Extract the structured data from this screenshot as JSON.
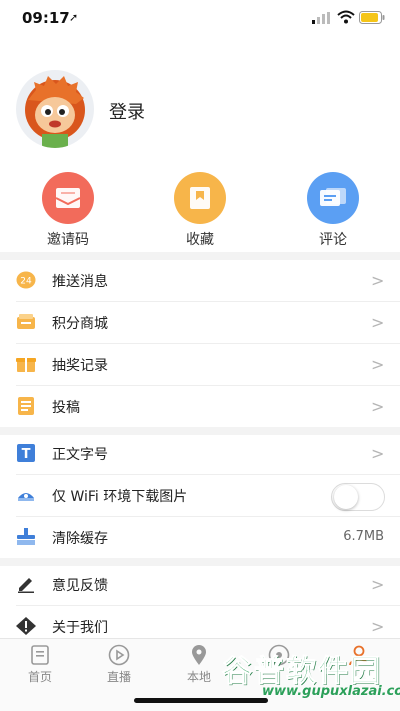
{
  "status_bar": {
    "time": "09:17",
    "location_arrow": "➚",
    "icons": [
      "signal-icon",
      "wifi-icon",
      "battery-icon"
    ],
    "battery_color": "#f5c518"
  },
  "profile": {
    "avatar_icon": "lion-mascot-avatar",
    "login_label": "登录"
  },
  "shortcuts": [
    {
      "label": "邀请码",
      "icon": "envelope-icon",
      "color": "#f26b5b"
    },
    {
      "label": "收藏",
      "icon": "bookmark-icon",
      "color": "#f7b54a"
    },
    {
      "label": "评论",
      "icon": "comment-icon",
      "color": "#5b9ff3"
    }
  ],
  "menu_group_1": [
    {
      "label": "推送消息",
      "icon": "push-message-icon"
    },
    {
      "label": "积分商城",
      "icon": "points-mall-icon"
    },
    {
      "label": "抽奖记录",
      "icon": "gift-icon"
    },
    {
      "label": "投稿",
      "icon": "document-icon"
    }
  ],
  "menu_group_2": {
    "font_size": {
      "label": "正文字号",
      "icon": "text-size-icon"
    },
    "wifi_images": {
      "label": "仅 WiFi 环境下载图片",
      "icon": "wifi-download-icon",
      "toggle_on": false
    },
    "clear_cache": {
      "label": "清除缓存",
      "icon": "clear-cache-icon",
      "value": "6.7MB"
    }
  },
  "menu_group_3": [
    {
      "label": "意见反馈",
      "icon": "pencil-icon"
    },
    {
      "label": "关于我们",
      "icon": "warning-icon"
    }
  ],
  "chevron": ">",
  "tabbar": [
    {
      "label": "首页",
      "icon": "home-icon"
    },
    {
      "label": "直播",
      "icon": "play-icon"
    },
    {
      "label": "本地",
      "icon": "location-pin-icon"
    },
    {
      "label": "",
      "icon": "video-icon"
    },
    {
      "label": "",
      "icon": "user-icon"
    }
  ],
  "watermark": {
    "title": "谷普软件园",
    "url": "www.gupuxlazai.com"
  },
  "colors": {
    "accent_green": "#2ca05a",
    "chevron_gray": "#b5b5b5",
    "divider": "#f3f3f3"
  }
}
